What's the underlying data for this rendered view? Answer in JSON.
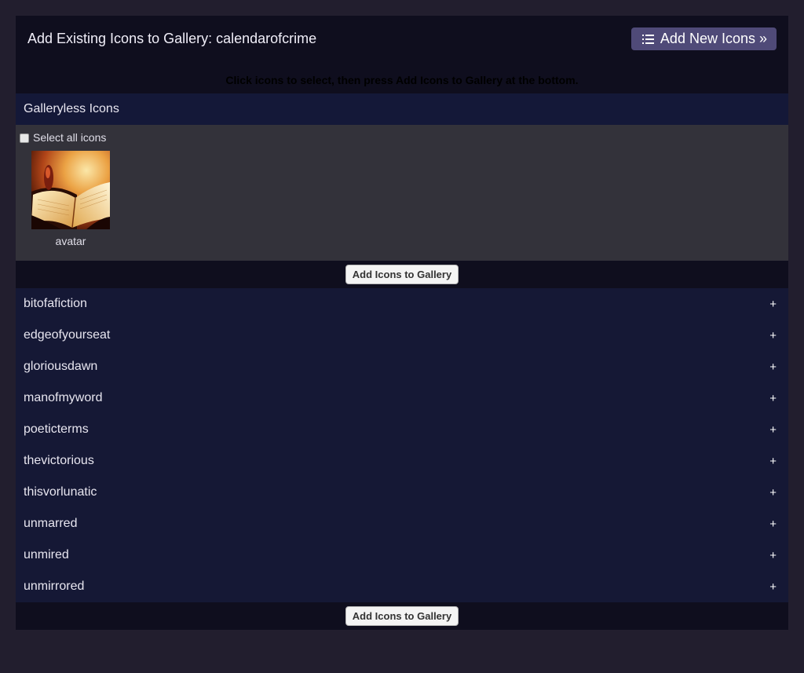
{
  "header": {
    "title": "Add Existing Icons to Gallery: calendarofcrime",
    "add_new_label": "Add New Icons »"
  },
  "instruction": "Click icons to select, then press Add Icons to Gallery at the bottom.",
  "galleryless": {
    "title": "Galleryless Icons",
    "select_all_label": "Select all icons",
    "icons": [
      {
        "label": "avatar",
        "icon": "open-book-image"
      }
    ]
  },
  "add_to_gallery_label": "Add Icons to Gallery",
  "galleries": [
    {
      "name": "bitofafiction",
      "toggle": "+"
    },
    {
      "name": "edgeofyourseat",
      "toggle": "+"
    },
    {
      "name": "gloriousdawn",
      "toggle": "+"
    },
    {
      "name": "manofmyword",
      "toggle": "+"
    },
    {
      "name": "poeticterms",
      "toggle": "+"
    },
    {
      "name": "thevictorious",
      "toggle": "+"
    },
    {
      "name": "thisvorlunatic",
      "toggle": "+"
    },
    {
      "name": "unmarred",
      "toggle": "+"
    },
    {
      "name": "unmired",
      "toggle": "+"
    },
    {
      "name": "unmirrored",
      "toggle": "+"
    }
  ],
  "colors": {
    "page_bg": "#221e2e",
    "panel_bg": "#0f0e1e",
    "section_bg": "#141838",
    "icons_area_bg": "#33323a",
    "button_accent": "#4f4a78"
  }
}
